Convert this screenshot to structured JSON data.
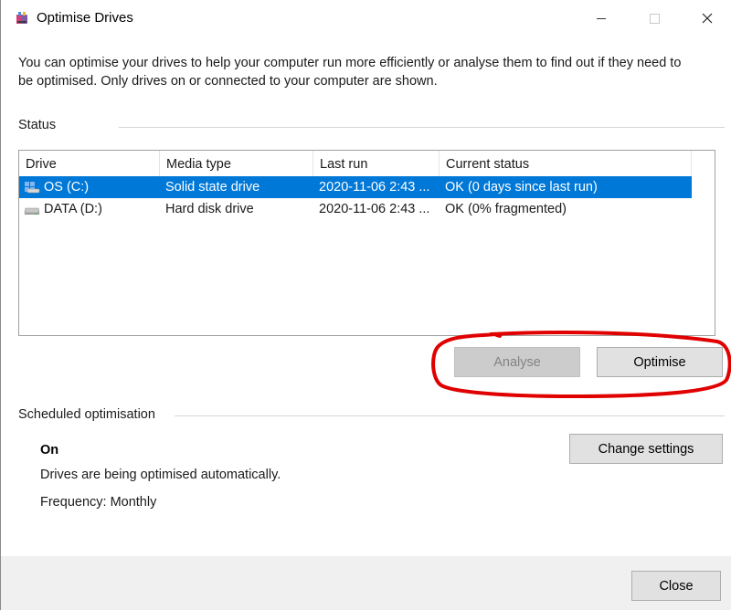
{
  "window": {
    "title": "Optimise Drives",
    "controls": {
      "minimize": "minimize-icon",
      "maximize": "maximize-icon",
      "close": "close-icon"
    }
  },
  "intro_text": "You can optimise your drives to help your computer run more efficiently or analyse them to find out if they need to be optimised. Only drives on or connected to your computer are shown.",
  "status": {
    "label": "Status",
    "columns": [
      "Drive",
      "Media type",
      "Last run",
      "Current status"
    ],
    "rows": [
      {
        "icon": "windows-drive-icon",
        "drive": "OS (C:)",
        "media_type": "Solid state drive",
        "last_run": "2020-11-06 2:43 ...",
        "current_status": "OK (0 days since last run)",
        "selected": true
      },
      {
        "icon": "hard-disk-icon",
        "drive": "DATA (D:)",
        "media_type": "Hard disk drive",
        "last_run": "2020-11-06 2:43 ...",
        "current_status": "OK (0% fragmented)",
        "selected": false
      }
    ],
    "analyse_label": "Analyse",
    "optimise_label": "Optimise"
  },
  "scheduled": {
    "label": "Scheduled optimisation",
    "state": "On",
    "description": "Drives are being optimised automatically.",
    "frequency": "Frequency: Monthly",
    "change_settings_label": "Change settings"
  },
  "footer": {
    "close_label": "Close"
  },
  "colors": {
    "selection": "#0078d7",
    "annotation": "#e00000",
    "button": "#e1e1e1",
    "footer": "#f0f0f0"
  }
}
